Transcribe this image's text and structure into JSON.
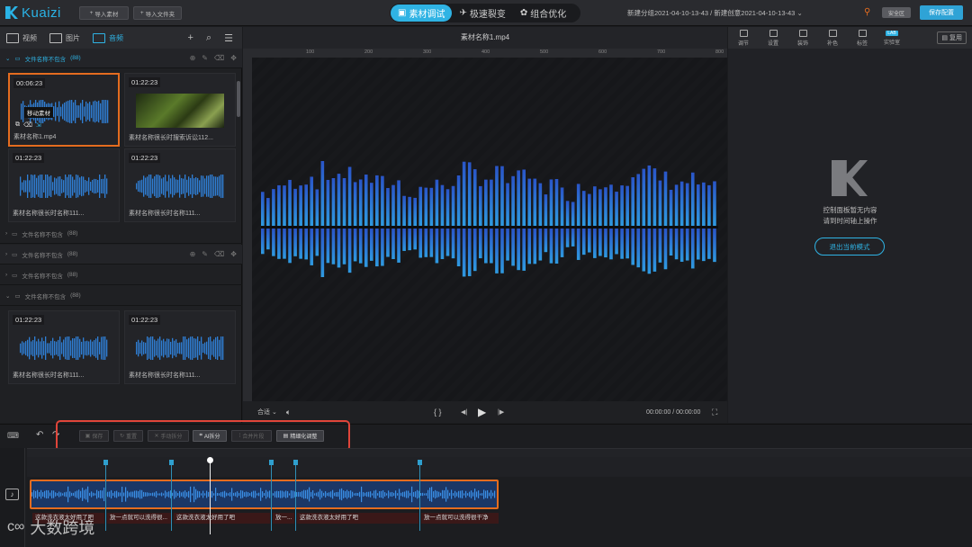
{
  "app": {
    "name": "Kuaizi"
  },
  "topbar": {
    "import_material": "导入素材",
    "import_folder": "导入文件夹",
    "modes": [
      {
        "label": "素材调试",
        "active": true
      },
      {
        "label": "极速裂变",
        "active": false
      },
      {
        "label": "组合优化",
        "active": false
      }
    ],
    "breadcrumb": "新建分组2021-04-10-13-43 / 新建创意2021-04-10-13-43",
    "safe_label": "安全区",
    "save_config": "保存配置"
  },
  "left": {
    "tabs": [
      {
        "label": "视频",
        "icon": "video-icon",
        "active": false
      },
      {
        "label": "图片",
        "icon": "image-icon",
        "active": false
      },
      {
        "label": "音频",
        "icon": "audio-icon",
        "active": true
      }
    ],
    "folder_label": "文件名称不包含",
    "folder_count": "(88)",
    "cards_top": [
      {
        "time": "00:06:23",
        "name": "素材名称1.mp4",
        "type": "audio",
        "selected": true
      },
      {
        "time": "01:22:23",
        "name": "素材名称很长时搜索诉讼112...",
        "type": "image",
        "selected": false
      },
      {
        "time": "01:22:23",
        "name": "素材名称很长时名称111...",
        "type": "audio",
        "selected": false
      },
      {
        "time": "01:22:23",
        "name": "素材名称很长时名称111...",
        "type": "audio",
        "selected": false
      }
    ],
    "cards_bottom": [
      {
        "time": "01:22:23",
        "name": "素材名称很长时名称111...",
        "type": "audio"
      },
      {
        "time": "01:22:23",
        "name": "素材名称很长时名称111...",
        "type": "audio"
      }
    ],
    "tooltip": "移动素材"
  },
  "preview": {
    "title": "素材名称1.mp4",
    "ruler_ticks": [
      "100",
      "200",
      "300",
      "400",
      "500",
      "600",
      "700",
      "800"
    ],
    "fit_label": "合适",
    "time_display": "00:00:00 / 00:00:00"
  },
  "right": {
    "tools": [
      "调节",
      "设置",
      "装饰",
      "补色",
      "标签",
      "实验室"
    ],
    "lab_badge": "LAB",
    "reuse": "复用",
    "empty_line1": "控制面板暂无内容",
    "empty_line2": "请到时间轴上操作",
    "exit_mode": "退出当前模式"
  },
  "timeline": {
    "buttons": [
      {
        "label": "保存",
        "enabled": false
      },
      {
        "label": "重置",
        "enabled": false
      },
      {
        "label": "手动拆分",
        "enabled": false
      },
      {
        "label": "AI拆分",
        "enabled": true
      },
      {
        "label": "合并片段",
        "enabled": false
      },
      {
        "label": "精细化调整",
        "enabled": true
      }
    ],
    "subtitles": [
      "这款洗衣液太好用了吧",
      "放一点就可以洗得很干净",
      "这款洗衣液太好用了吧",
      "放一...",
      "这款洗衣液太好用了吧",
      "放一点就可以洗得很干净"
    ],
    "subtitle_labels": [
      "这款洗衣液太好用了吧",
      "放一点就可以洗得很...",
      "这款洗衣液太好用了吧",
      "放一...",
      "这款洗衣液太好用了吧",
      "放一点就可以洗得很干净"
    ]
  },
  "watermark": {
    "text": "大数跨境"
  },
  "colors": {
    "accent": "#2fb3e4",
    "selection": "#e46c1f",
    "highlight_box": "#e0453a",
    "wave": "#2f7fd6"
  }
}
